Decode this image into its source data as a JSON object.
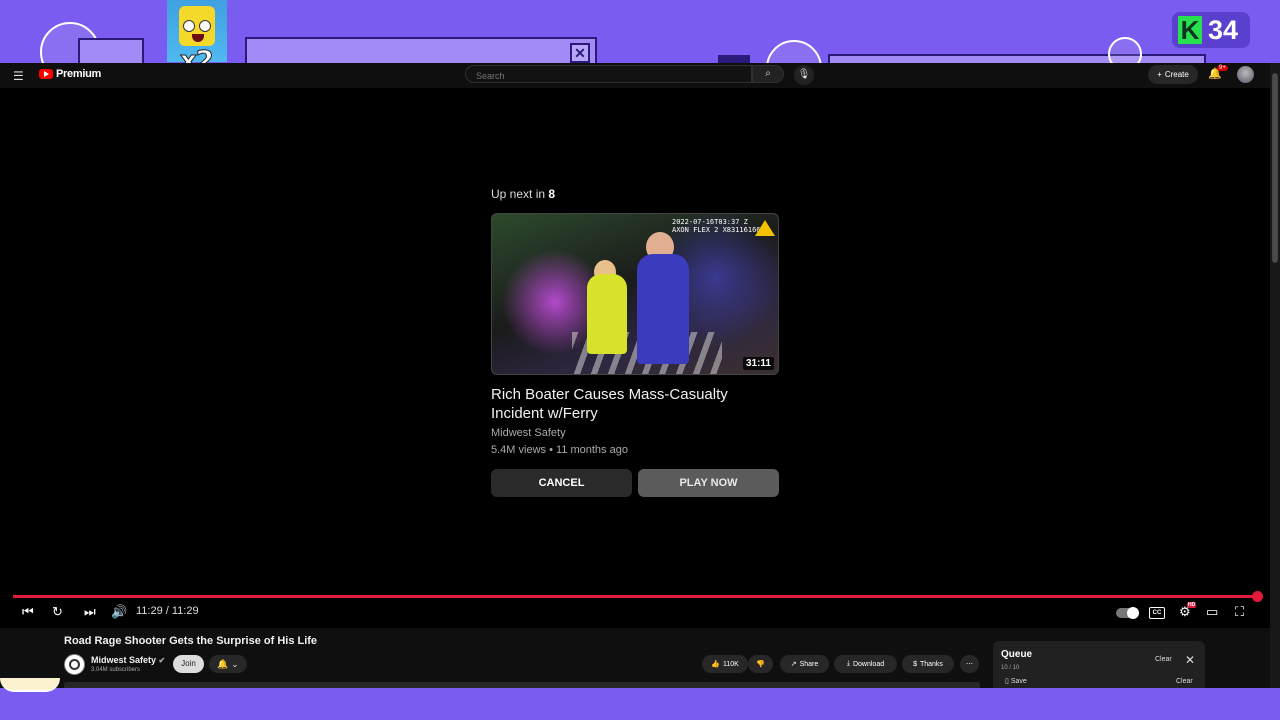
{
  "overlay": {
    "multiplier": "x2",
    "k_logo": "K",
    "k_count": "34"
  },
  "masthead": {
    "brand": "Premium",
    "search_placeholder": "Search",
    "create_label": "Create",
    "notification_count": "9+"
  },
  "endscreen": {
    "up_next_prefix": "Up next in",
    "countdown": "8",
    "video_title": "Rich Boater Causes Mass-Casualty Incident w/Ferry",
    "channel": "Midwest Safety",
    "meta": "5.4M views • 11 months ago",
    "duration": "31:11",
    "timestamp_overlay": "2022-07-16T03:37 Z",
    "camera_label": "AXON FLEX 2 X83116166",
    "cancel_label": "CANCEL",
    "play_label": "PLAY NOW"
  },
  "player": {
    "time": "11:29 / 11:29",
    "progress": 1.0,
    "cc_label": "CC",
    "hd_label": "HD",
    "accent_color": "#e01b3c"
  },
  "video": {
    "title": "Road Rage Shooter Gets the Surprise of His Life",
    "channel": "Midwest Safety",
    "subscribers": "3.04M subscribers",
    "join_label": "Join",
    "likes": "110K",
    "share_label": "Share",
    "download_label": "Download",
    "thanks_label": "Thanks"
  },
  "queue": {
    "title": "Queue",
    "count": "10 / 10",
    "clear_label": "Clear",
    "save_label": "Save",
    "clear_label_2": "Clear"
  }
}
